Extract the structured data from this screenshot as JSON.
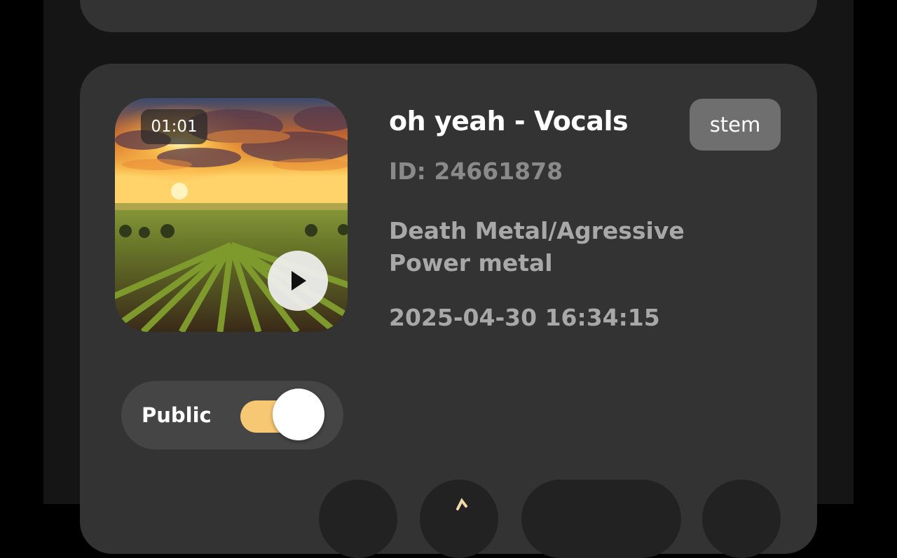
{
  "track": {
    "title": "oh yeah - Vocals",
    "id_text": "ID: 24661878",
    "genre_line1": "Death Metal/Agressive",
    "genre_line2": "Power metal",
    "created_at": "2025-04-30 16:34:15",
    "duration": "01:01",
    "badge": "stem"
  },
  "visibility": {
    "label": "Public",
    "enabled": true
  },
  "icons": {
    "play": "play-icon",
    "action_2": "share-icon"
  },
  "colors": {
    "background": "#000000",
    "panel": "#151515",
    "card": "#333333",
    "toggle_on": "#f7c873",
    "badge": "#6f6f6f"
  }
}
